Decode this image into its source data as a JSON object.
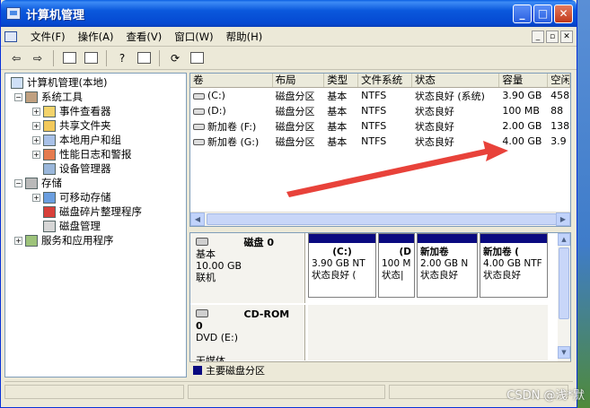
{
  "window": {
    "title": "计算机管理"
  },
  "menu": {
    "items": [
      "文件(F)",
      "操作(A)",
      "查看(V)",
      "窗口(W)",
      "帮助(H)"
    ]
  },
  "tree": {
    "root": "计算机管理(本地)",
    "items": [
      {
        "label": "系统工具",
        "level": 1,
        "expander": "−",
        "icon": "tools-icon"
      },
      {
        "label": "事件查看器",
        "level": 2,
        "expander": "+",
        "icon": "event-viewer-icon"
      },
      {
        "label": "共享文件夹",
        "level": 2,
        "expander": "+",
        "icon": "shared-folder-icon"
      },
      {
        "label": "本地用户和组",
        "level": 2,
        "expander": "+",
        "icon": "users-icon"
      },
      {
        "label": "性能日志和警报",
        "level": 2,
        "expander": "+",
        "icon": "performance-icon"
      },
      {
        "label": "设备管理器",
        "level": 2,
        "expander": "",
        "icon": "device-manager-icon"
      },
      {
        "label": "存储",
        "level": 1,
        "expander": "−",
        "icon": "storage-icon"
      },
      {
        "label": "可移动存储",
        "level": 2,
        "expander": "+",
        "icon": "removable-storage-icon"
      },
      {
        "label": "磁盘碎片整理程序",
        "level": 2,
        "expander": "",
        "icon": "defrag-icon"
      },
      {
        "label": "磁盘管理",
        "level": 2,
        "expander": "",
        "icon": "disk-management-icon"
      },
      {
        "label": "服务和应用程序",
        "level": 1,
        "expander": "+",
        "icon": "services-icon"
      }
    ]
  },
  "volumes": {
    "columns": [
      "卷",
      "布局",
      "类型",
      "文件系统",
      "状态",
      "容量",
      "空闲"
    ],
    "rows": [
      [
        "(C:)",
        "磁盘分区",
        "基本",
        "NTFS",
        "状态良好 (系统)",
        "3.90 GB",
        "458"
      ],
      [
        "(D:)",
        "磁盘分区",
        "基本",
        "NTFS",
        "状态良好",
        "100 MB",
        "88"
      ],
      [
        "新加卷 (F:)",
        "磁盘分区",
        "基本",
        "NTFS",
        "状态良好",
        "2.00 GB",
        "138"
      ],
      [
        "新加卷 (G:)",
        "磁盘分区",
        "基本",
        "NTFS",
        "状态良好",
        "4.00 GB",
        "3.9"
      ]
    ]
  },
  "disks": [
    {
      "name": "磁盘 0",
      "lines": [
        "基本",
        "10.00 GB",
        "联机"
      ],
      "partitions": [
        {
          "title": "(C:)",
          "size": "3.90 GB NT",
          "status": "状态良好 ("
        },
        {
          "title": "(D",
          "size": "100 M",
          "status": "状态|"
        },
        {
          "title": "新加卷",
          "size": "2.00 GB N",
          "status": "状态良好"
        },
        {
          "title": "新加卷 (",
          "size": "4.00 GB NTF",
          "status": "状态良好"
        }
      ]
    },
    {
      "name": "CD-ROM 0",
      "lines": [
        "DVD (E:)",
        "",
        "无媒体"
      ]
    }
  ],
  "legend": {
    "primary": "主要磁盘分区"
  },
  "watermark": "CSDN @浅*默"
}
